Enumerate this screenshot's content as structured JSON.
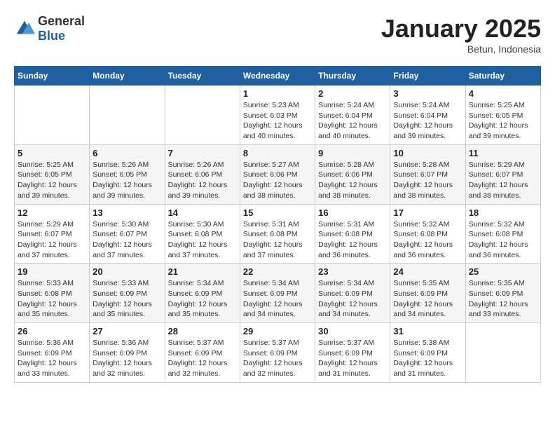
{
  "logo": {
    "general": "General",
    "blue": "Blue"
  },
  "header": {
    "month": "January 2025",
    "location": "Betun, Indonesia"
  },
  "weekdays": [
    "Sunday",
    "Monday",
    "Tuesday",
    "Wednesday",
    "Thursday",
    "Friday",
    "Saturday"
  ],
  "weeks": [
    [
      {
        "day": null,
        "info": null
      },
      {
        "day": null,
        "info": null
      },
      {
        "day": null,
        "info": null
      },
      {
        "day": "1",
        "info": "Sunrise: 5:23 AM\nSunset: 6:03 PM\nDaylight: 12 hours\nand 40 minutes."
      },
      {
        "day": "2",
        "info": "Sunrise: 5:24 AM\nSunset: 6:04 PM\nDaylight: 12 hours\nand 40 minutes."
      },
      {
        "day": "3",
        "info": "Sunrise: 5:24 AM\nSunset: 6:04 PM\nDaylight: 12 hours\nand 39 minutes."
      },
      {
        "day": "4",
        "info": "Sunrise: 5:25 AM\nSunset: 6:05 PM\nDaylight: 12 hours\nand 39 minutes."
      }
    ],
    [
      {
        "day": "5",
        "info": "Sunrise: 5:25 AM\nSunset: 6:05 PM\nDaylight: 12 hours\nand 39 minutes."
      },
      {
        "day": "6",
        "info": "Sunrise: 5:26 AM\nSunset: 6:05 PM\nDaylight: 12 hours\nand 39 minutes."
      },
      {
        "day": "7",
        "info": "Sunrise: 5:26 AM\nSunset: 6:06 PM\nDaylight: 12 hours\nand 39 minutes."
      },
      {
        "day": "8",
        "info": "Sunrise: 5:27 AM\nSunset: 6:06 PM\nDaylight: 12 hours\nand 38 minutes."
      },
      {
        "day": "9",
        "info": "Sunrise: 5:28 AM\nSunset: 6:06 PM\nDaylight: 12 hours\nand 38 minutes."
      },
      {
        "day": "10",
        "info": "Sunrise: 5:28 AM\nSunset: 6:07 PM\nDaylight: 12 hours\nand 38 minutes."
      },
      {
        "day": "11",
        "info": "Sunrise: 5:29 AM\nSunset: 6:07 PM\nDaylight: 12 hours\nand 38 minutes."
      }
    ],
    [
      {
        "day": "12",
        "info": "Sunrise: 5:29 AM\nSunset: 6:07 PM\nDaylight: 12 hours\nand 37 minutes."
      },
      {
        "day": "13",
        "info": "Sunrise: 5:30 AM\nSunset: 6:07 PM\nDaylight: 12 hours\nand 37 minutes."
      },
      {
        "day": "14",
        "info": "Sunrise: 5:30 AM\nSunset: 6:08 PM\nDaylight: 12 hours\nand 37 minutes."
      },
      {
        "day": "15",
        "info": "Sunrise: 5:31 AM\nSunset: 6:08 PM\nDaylight: 12 hours\nand 37 minutes."
      },
      {
        "day": "16",
        "info": "Sunrise: 5:31 AM\nSunset: 6:08 PM\nDaylight: 12 hours\nand 36 minutes."
      },
      {
        "day": "17",
        "info": "Sunrise: 5:32 AM\nSunset: 6:08 PM\nDaylight: 12 hours\nand 36 minutes."
      },
      {
        "day": "18",
        "info": "Sunrise: 5:32 AM\nSunset: 6:08 PM\nDaylight: 12 hours\nand 36 minutes."
      }
    ],
    [
      {
        "day": "19",
        "info": "Sunrise: 5:33 AM\nSunset: 6:08 PM\nDaylight: 12 hours\nand 35 minutes."
      },
      {
        "day": "20",
        "info": "Sunrise: 5:33 AM\nSunset: 6:09 PM\nDaylight: 12 hours\nand 35 minutes."
      },
      {
        "day": "21",
        "info": "Sunrise: 5:34 AM\nSunset: 6:09 PM\nDaylight: 12 hours\nand 35 minutes."
      },
      {
        "day": "22",
        "info": "Sunrise: 5:34 AM\nSunset: 6:09 PM\nDaylight: 12 hours\nand 34 minutes."
      },
      {
        "day": "23",
        "info": "Sunrise: 5:34 AM\nSunset: 6:09 PM\nDaylight: 12 hours\nand 34 minutes."
      },
      {
        "day": "24",
        "info": "Sunrise: 5:35 AM\nSunset: 6:09 PM\nDaylight: 12 hours\nand 34 minutes."
      },
      {
        "day": "25",
        "info": "Sunrise: 5:35 AM\nSunset: 6:09 PM\nDaylight: 12 hours\nand 33 minutes."
      }
    ],
    [
      {
        "day": "26",
        "info": "Sunrise: 5:36 AM\nSunset: 6:09 PM\nDaylight: 12 hours\nand 33 minutes."
      },
      {
        "day": "27",
        "info": "Sunrise: 5:36 AM\nSunset: 6:09 PM\nDaylight: 12 hours\nand 32 minutes."
      },
      {
        "day": "28",
        "info": "Sunrise: 5:37 AM\nSunset: 6:09 PM\nDaylight: 12 hours\nand 32 minutes."
      },
      {
        "day": "29",
        "info": "Sunrise: 5:37 AM\nSunset: 6:09 PM\nDaylight: 12 hours\nand 32 minutes."
      },
      {
        "day": "30",
        "info": "Sunrise: 5:37 AM\nSunset: 6:09 PM\nDaylight: 12 hours\nand 31 minutes."
      },
      {
        "day": "31",
        "info": "Sunrise: 5:38 AM\nSunset: 6:09 PM\nDaylight: 12 hours\nand 31 minutes."
      },
      {
        "day": null,
        "info": null
      }
    ]
  ]
}
